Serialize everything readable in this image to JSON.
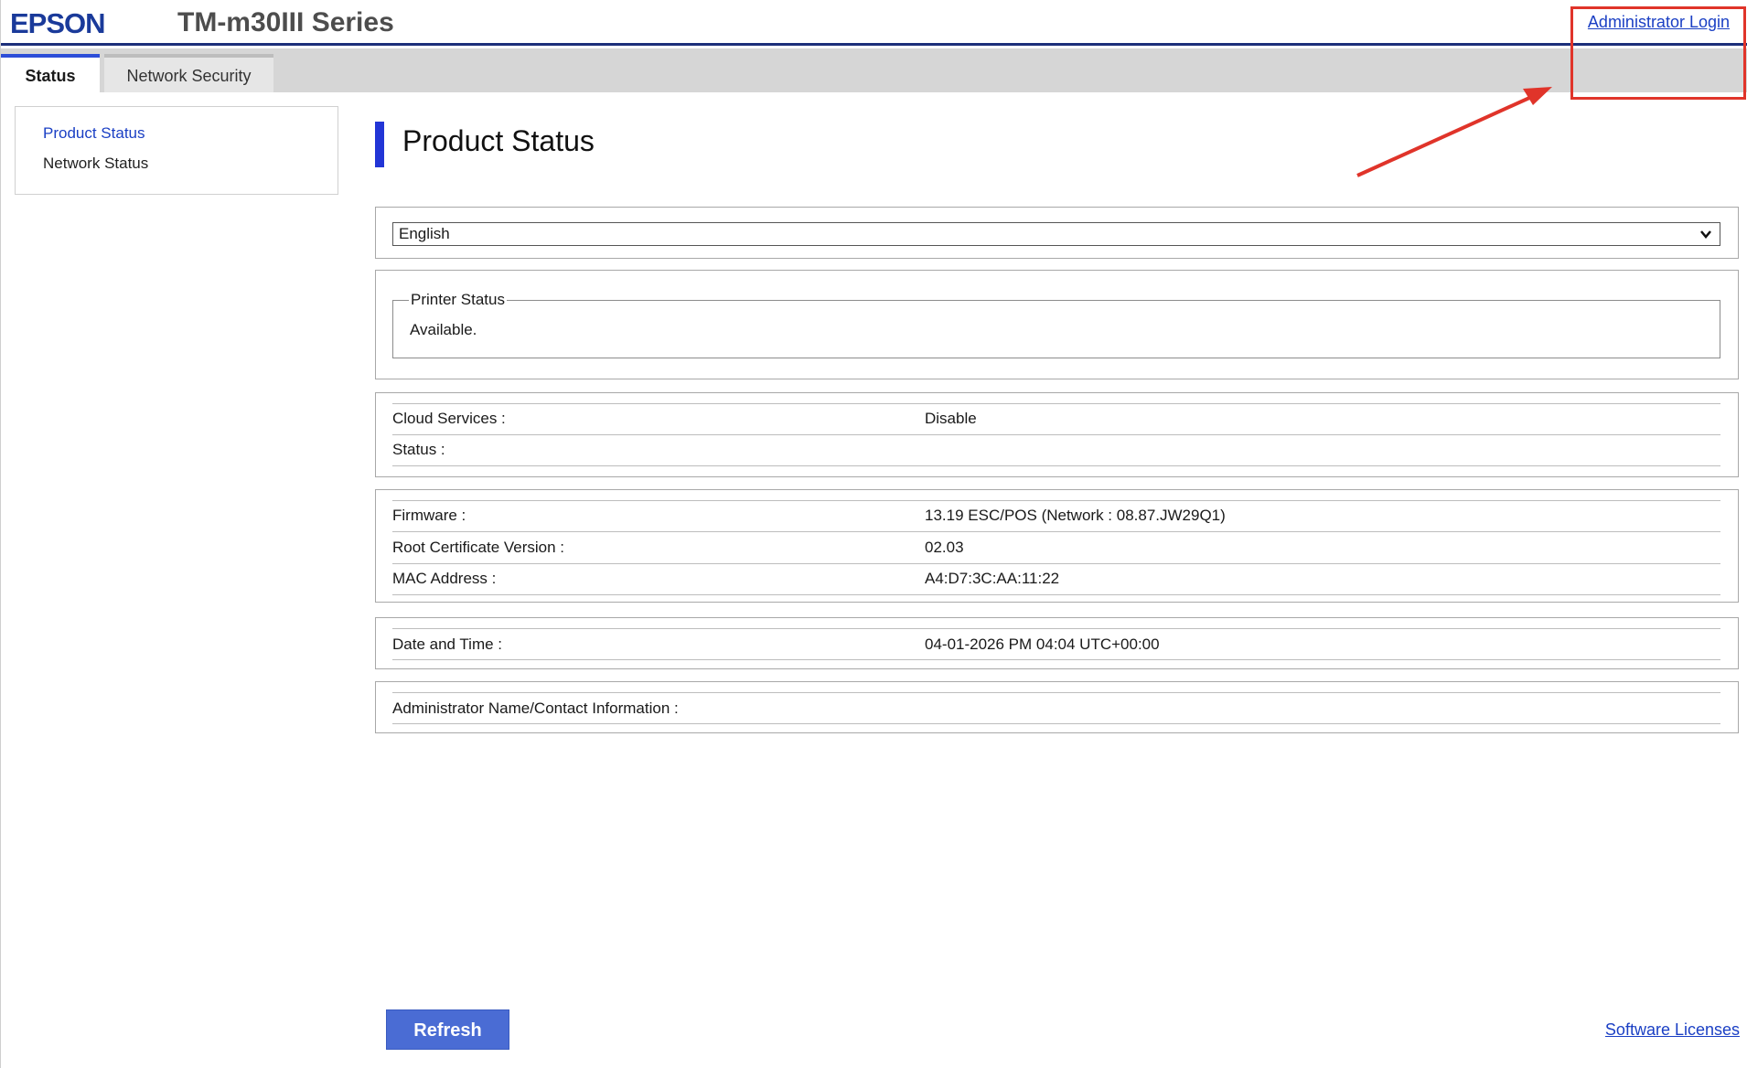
{
  "header": {
    "logo": "EPSON",
    "model": "TM-m30III Series",
    "admin_login": "Administrator Login"
  },
  "tabs": [
    {
      "label": "Status",
      "active": true
    },
    {
      "label": "Network Security",
      "active": false
    }
  ],
  "sidebar": {
    "items": [
      {
        "label": "Product Status",
        "selected": true
      },
      {
        "label": "Network Status",
        "selected": false
      }
    ]
  },
  "main": {
    "title": "Product Status",
    "language": {
      "selected": "English"
    },
    "printer_status": {
      "legend": "Printer Status",
      "value": "Available."
    },
    "cloud": {
      "rows": [
        {
          "label": "Cloud Services :",
          "value": "Disable"
        },
        {
          "label": "Status :",
          "value": ""
        }
      ]
    },
    "device": {
      "rows": [
        {
          "label": "Firmware :",
          "value": "13.19 ESC/POS (Network : 08.87.JW29Q1)"
        },
        {
          "label": "Root Certificate Version :",
          "value": "02.03"
        },
        {
          "label": "MAC Address :",
          "value": "A4:D7:3C:AA:11:22"
        }
      ]
    },
    "datetime": {
      "label": "Date and Time :",
      "value": "04-01-2026 PM 04:04 UTC+00:00"
    },
    "admin_contact": {
      "label": "Administrator Name/Contact Information :",
      "value": ""
    }
  },
  "footer": {
    "refresh": "Refresh",
    "software_licenses": "Software Licenses"
  },
  "colors": {
    "accent": "#2235d6",
    "link": "#1a3fc4",
    "button": "#4a6cd4",
    "annotation": "#e0342a"
  }
}
